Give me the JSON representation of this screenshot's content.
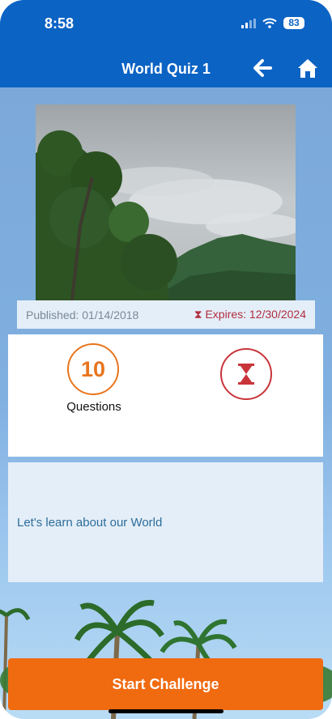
{
  "status_bar": {
    "time": "8:58",
    "battery": "83"
  },
  "header": {
    "title": "World Quiz 1",
    "back_icon": "arrow-left-icon",
    "home_icon": "home-icon"
  },
  "quiz": {
    "published": "Published: 01/14/2018",
    "expires": "Expires: 12/30/2024",
    "question_count": "10",
    "questions_label": "Questions",
    "description": "Let's learn about our World"
  },
  "actions": {
    "start_label": "Start Challenge"
  },
  "colors": {
    "header": "#0b63c4",
    "accent_orange": "#f06a10",
    "expires_red": "#b12d3e"
  }
}
